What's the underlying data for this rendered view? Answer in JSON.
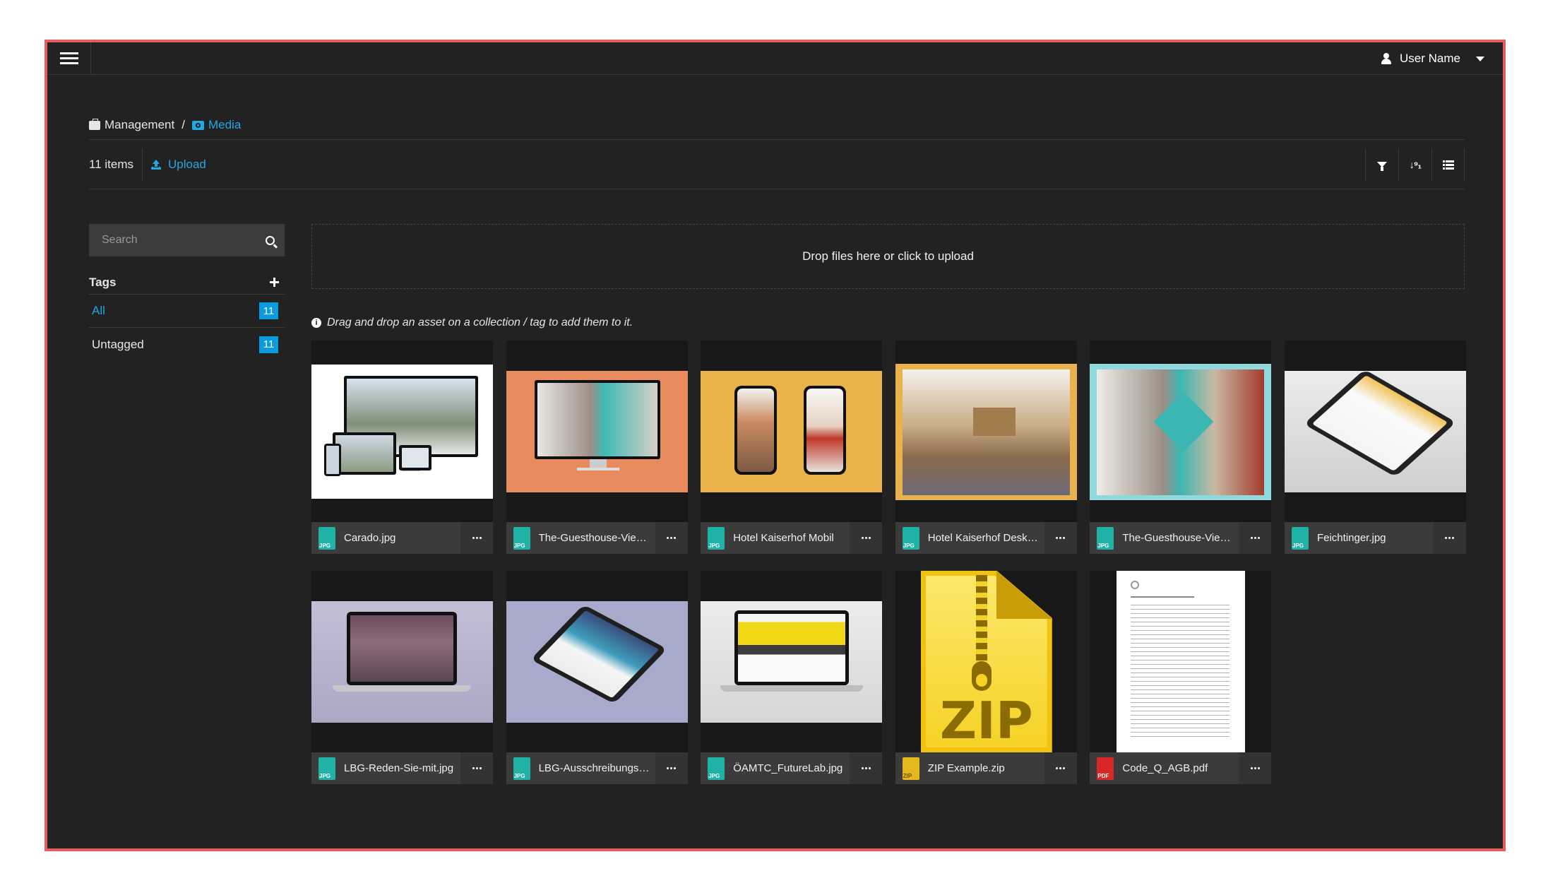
{
  "topbar": {
    "user_name": "User Name"
  },
  "breadcrumb": {
    "items": [
      "Management",
      "Media"
    ],
    "separator": "/"
  },
  "toolbar": {
    "items_count": "11 items",
    "upload_label": "Upload"
  },
  "sidebar": {
    "search_placeholder": "Search",
    "tags_title": "Tags",
    "tags": [
      {
        "label": "All",
        "count": "11"
      },
      {
        "label": "Untagged",
        "count": "11"
      }
    ]
  },
  "main": {
    "dropzone_text": "Drop files here or click to upload",
    "hint_text": "Drag and drop an asset on a collection / tag to add them to it.",
    "assets": [
      {
        "name": "Carado.jpg",
        "type": "JPG"
      },
      {
        "name": "The-Guesthouse-Vienn...",
        "type": "JPG"
      },
      {
        "name": "Hotel Kaiserhof Mobil",
        "type": "JPG"
      },
      {
        "name": "Hotel Kaiserhof Desktop",
        "type": "JPG"
      },
      {
        "name": "The-Guesthouse-Vienn...",
        "type": "JPG"
      },
      {
        "name": "Feichtinger.jpg",
        "type": "JPG"
      },
      {
        "name": "LBG-Reden-Sie-mit.jpg",
        "type": "JPG"
      },
      {
        "name": "LBG-Ausschreibungspl...",
        "type": "JPG"
      },
      {
        "name": "ÖAMTC_FutureLab.jpg",
        "type": "JPG"
      },
      {
        "name": "ZIP Example.zip",
        "type": "ZIP"
      },
      {
        "name": "Code_Q_AGB.pdf",
        "type": "PDF"
      }
    ],
    "zip_big_label": "ZIP"
  },
  "colors": {
    "frame_border": "#e95a5c",
    "background": "#222222",
    "accent": "#22a7e3",
    "badge": "#0a9ae0",
    "jpg_icon": "#1fb3a8",
    "zip_icon": "#e6b820",
    "pdf_icon": "#d82828"
  }
}
